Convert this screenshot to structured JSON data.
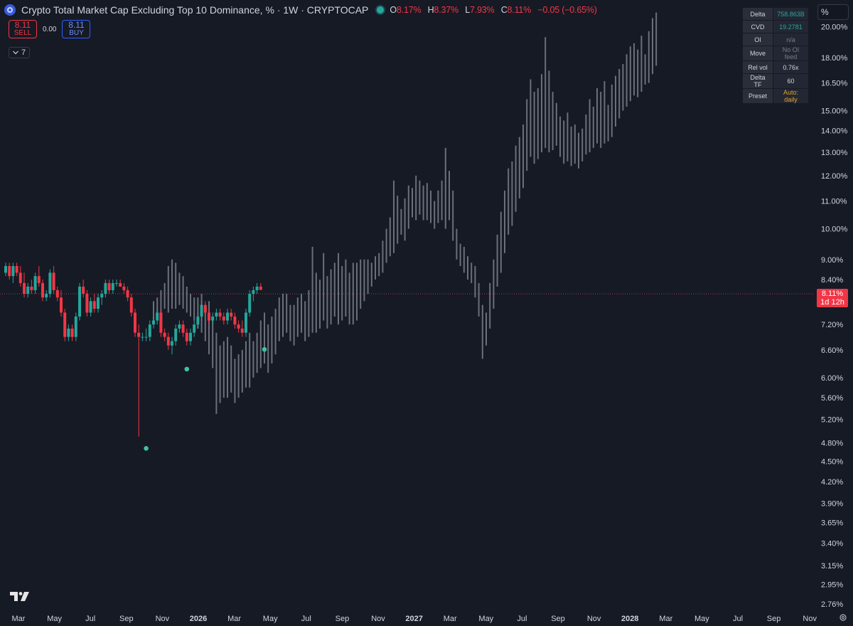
{
  "header": {
    "title": "Crypto Total Market Cap Excluding Top 10 Dominance, % · 1W · CRYPTOCAP",
    "ohlc": {
      "o_key": "O",
      "o_val": "8.17%",
      "h_key": "H",
      "h_val": "8.37%",
      "l_key": "L",
      "l_val": "7.93%",
      "c_key": "C",
      "c_val": "8.11%",
      "change": "−0.05 (−0.65%)"
    }
  },
  "trade": {
    "sell_price": "8.11",
    "sell_label": "SELL",
    "spread": "0.00",
    "buy_price": "8.11",
    "buy_label": "BUY"
  },
  "indicators_toggle": {
    "count": "7"
  },
  "axis_button": {
    "label": "%"
  },
  "data_table": [
    {
      "label": "Delta",
      "value": "758.863B",
      "color": "#26a69a"
    },
    {
      "label": "CVD",
      "value": "19.2781",
      "color": "#26a69a"
    },
    {
      "label": "OI",
      "value": "n/a",
      "color": "#787b86"
    },
    {
      "label": "Move",
      "value": "No OI feed",
      "color": "#787b86"
    },
    {
      "label": "Rel vol",
      "value": "0.76x",
      "color": "#d1d4dc"
    },
    {
      "label": "Delta TF",
      "value": "60",
      "color": "#d1d4dc"
    },
    {
      "label": "Preset",
      "value": "Auto: daily",
      "color": "#e0a32e"
    }
  ],
  "price_tag": {
    "value": "8.11%",
    "countdown": "1d 12h"
  },
  "chart_data": {
    "type": "candlestick",
    "title": "Crypto Total Market Cap Excluding Top 10 Dominance, %",
    "y_scale": "log",
    "ylim": [
      2.7,
      21.5
    ],
    "y_ticks": [
      "20.00%",
      "18.00%",
      "16.50%",
      "15.00%",
      "14.00%",
      "13.00%",
      "12.00%",
      "11.00%",
      "10.00%",
      "9.00%",
      "8.40%",
      "7.20%",
      "6.60%",
      "6.00%",
      "5.60%",
      "5.20%",
      "4.80%",
      "4.50%",
      "4.20%",
      "3.90%",
      "3.65%",
      "3.40%",
      "3.15%",
      "2.95%",
      "2.76%"
    ],
    "x_ticks": [
      "Mar",
      "May",
      "Jul",
      "Sep",
      "Nov",
      "2026",
      "Mar",
      "May",
      "Jul",
      "Sep",
      "Nov",
      "2027",
      "Mar",
      "May",
      "Jul",
      "Sep",
      "Nov",
      "2028",
      "Mar",
      "May",
      "Jul",
      "Sep",
      "Nov"
    ],
    "bold_x_ticks": [
      "2026",
      "2027",
      "2028"
    ],
    "current_value": 8.11,
    "colors": {
      "up": "#26a69a",
      "down": "#f23645",
      "projection": "#6b6f7a",
      "background": "#161a25"
    },
    "candles": [
      [
        8.6,
        8.9,
        8.5,
        8.8
      ],
      [
        8.8,
        8.9,
        8.4,
        8.5
      ],
      [
        8.5,
        8.9,
        8.3,
        8.8
      ],
      [
        8.8,
        8.9,
        8.5,
        8.6
      ],
      [
        8.6,
        8.8,
        8.2,
        8.3
      ],
      [
        8.3,
        8.6,
        7.9,
        8.0
      ],
      [
        8.0,
        8.3,
        7.9,
        8.2
      ],
      [
        8.2,
        8.4,
        8.0,
        8.1
      ],
      [
        8.1,
        8.6,
        8.0,
        8.5
      ],
      [
        8.5,
        8.8,
        8.2,
        8.3
      ],
      [
        8.3,
        8.4,
        7.8,
        7.9
      ],
      [
        7.9,
        8.1,
        7.8,
        8.0
      ],
      [
        8.0,
        8.7,
        7.9,
        8.6
      ],
      [
        8.6,
        8.8,
        8.0,
        8.1
      ],
      [
        8.1,
        8.2,
        7.8,
        7.9
      ],
      [
        7.9,
        8.1,
        7.4,
        7.5
      ],
      [
        7.5,
        7.6,
        6.8,
        6.9
      ],
      [
        6.9,
        7.2,
        6.8,
        7.1
      ],
      [
        7.1,
        7.2,
        6.8,
        6.9
      ],
      [
        6.9,
        7.5,
        6.8,
        7.4
      ],
      [
        7.4,
        8.3,
        7.3,
        8.2
      ],
      [
        8.2,
        8.4,
        7.9,
        8.0
      ],
      [
        8.0,
        8.1,
        7.4,
        7.5
      ],
      [
        7.5,
        7.9,
        7.4,
        7.8
      ],
      [
        7.8,
        8.0,
        7.5,
        7.6
      ],
      [
        7.6,
        8.0,
        7.5,
        7.9
      ],
      [
        7.9,
        8.1,
        7.7,
        8.0
      ],
      [
        8.0,
        8.4,
        7.9,
        8.3
      ],
      [
        8.3,
        8.4,
        8.0,
        8.1
      ],
      [
        8.1,
        8.4,
        8.0,
        8.3
      ],
      [
        8.3,
        8.4,
        8.2,
        8.3
      ],
      [
        8.3,
        8.4,
        8.2,
        8.2
      ],
      [
        8.2,
        8.3,
        8.0,
        8.1
      ],
      [
        8.1,
        8.2,
        7.8,
        7.9
      ],
      [
        7.9,
        8.0,
        7.4,
        7.5
      ],
      [
        7.5,
        7.6,
        6.9,
        7.0
      ],
      [
        7.0,
        7.2,
        4.9,
        6.9
      ],
      [
        6.9,
        7.0,
        6.8,
        6.9
      ],
      [
        6.9,
        7.1,
        6.8,
        6.9
      ],
      [
        6.9,
        7.3,
        6.8,
        7.2
      ],
      [
        7.2,
        7.4,
        7.1,
        7.3
      ],
      [
        7.3,
        7.6,
        7.2,
        7.5
      ],
      [
        7.5,
        7.6,
        6.9,
        7.0
      ],
      [
        7.0,
        7.1,
        6.8,
        6.9
      ],
      [
        6.9,
        7.0,
        6.6,
        6.7
      ],
      [
        6.7,
        6.9,
        6.5,
        6.8
      ],
      [
        6.8,
        7.2,
        6.7,
        7.1
      ],
      [
        7.1,
        7.3,
        7.0,
        7.2
      ],
      [
        7.2,
        7.3,
        6.9,
        7.0
      ],
      [
        7.0,
        7.1,
        6.7,
        6.8
      ],
      [
        6.8,
        7.1,
        6.7,
        7.0
      ],
      [
        7.0,
        7.3,
        6.9,
        7.2
      ],
      [
        7.2,
        7.5,
        7.1,
        7.4
      ],
      [
        7.4,
        7.8,
        7.3,
        7.7
      ],
      [
        7.7,
        7.8,
        7.4,
        7.5
      ],
      [
        7.5,
        7.6,
        7.2,
        7.3
      ],
      [
        7.3,
        7.5,
        7.2,
        7.4
      ],
      [
        7.4,
        7.6,
        7.3,
        7.5
      ],
      [
        7.5,
        7.6,
        7.3,
        7.4
      ],
      [
        7.4,
        7.5,
        7.2,
        7.3
      ],
      [
        7.3,
        7.6,
        7.2,
        7.5
      ],
      [
        7.5,
        7.6,
        7.3,
        7.4
      ],
      [
        7.4,
        7.5,
        7.1,
        7.2
      ],
      [
        7.2,
        7.3,
        7.0,
        7.1
      ],
      [
        7.1,
        7.3,
        6.9,
        7.0
      ],
      [
        7.0,
        7.6,
        6.9,
        7.5
      ],
      [
        7.5,
        8.1,
        7.4,
        8.0
      ],
      [
        8.0,
        8.2,
        7.8,
        8.1
      ],
      [
        8.1,
        8.3,
        8.0,
        8.2
      ],
      [
        8.2,
        8.3,
        8.1,
        8.11
      ]
    ],
    "projection": [
      [
        7.3,
        7.8
      ],
      [
        7.4,
        7.9
      ],
      [
        7.5,
        8.1
      ],
      [
        7.6,
        8.3
      ],
      [
        7.5,
        8.8
      ],
      [
        7.6,
        9.0
      ],
      [
        7.6,
        8.9
      ],
      [
        7.7,
        8.6
      ],
      [
        7.6,
        8.5
      ],
      [
        7.5,
        8.2
      ],
      [
        7.4,
        8.0
      ],
      [
        7.3,
        7.9
      ],
      [
        7.1,
        7.9
      ],
      [
        7.0,
        8.0
      ],
      [
        6.8,
        7.7
      ],
      [
        6.5,
        7.8
      ],
      [
        6.2,
        7.4
      ],
      [
        5.3,
        7.0
      ],
      [
        5.5,
        6.7
      ],
      [
        5.6,
        6.8
      ],
      [
        5.6,
        6.9
      ],
      [
        5.7,
        6.7
      ],
      [
        5.5,
        6.4
      ],
      [
        5.6,
        6.5
      ],
      [
        5.7,
        6.6
      ],
      [
        5.8,
        6.8
      ],
      [
        5.8,
        7.0
      ],
      [
        6.0,
        6.8
      ],
      [
        6.1,
        7.0
      ],
      [
        6.2,
        7.3
      ],
      [
        6.3,
        7.5
      ],
      [
        6.1,
        7.2
      ],
      [
        6.3,
        7.4
      ],
      [
        6.5,
        7.6
      ],
      [
        6.8,
        7.9
      ],
      [
        6.9,
        8.0
      ],
      [
        7.0,
        8.0
      ],
      [
        6.8,
        7.7
      ],
      [
        6.7,
        7.7
      ],
      [
        6.9,
        7.9
      ],
      [
        7.0,
        8.0
      ],
      [
        6.8,
        7.8
      ],
      [
        6.9,
        8.1
      ],
      [
        7.0,
        9.4
      ],
      [
        7.0,
        8.6
      ],
      [
        7.1,
        8.4
      ],
      [
        7.3,
        9.2
      ],
      [
        7.1,
        8.5
      ],
      [
        7.2,
        8.7
      ],
      [
        7.4,
        8.9
      ],
      [
        7.2,
        9.2
      ],
      [
        7.3,
        8.8
      ],
      [
        7.4,
        9.0
      ],
      [
        7.2,
        8.6
      ],
      [
        7.2,
        8.9
      ],
      [
        7.3,
        8.9
      ],
      [
        7.6,
        9.0
      ],
      [
        7.8,
        9.0
      ],
      [
        8.0,
        9.0
      ],
      [
        8.2,
        8.9
      ],
      [
        8.4,
        9.1
      ],
      [
        8.5,
        9.2
      ],
      [
        8.6,
        9.6
      ],
      [
        8.9,
        10.0
      ],
      [
        9.1,
        10.4
      ],
      [
        9.2,
        11.8
      ],
      [
        9.5,
        11.2
      ],
      [
        9.8,
        10.7
      ],
      [
        9.6,
        11.1
      ],
      [
        10.0,
        11.6
      ],
      [
        10.4,
        11.5
      ],
      [
        10.3,
        12.0
      ],
      [
        10.5,
        11.8
      ],
      [
        10.3,
        11.6
      ],
      [
        10.3,
        11.7
      ],
      [
        10.2,
        11.4
      ],
      [
        10.0,
        11.0
      ],
      [
        10.2,
        11.4
      ],
      [
        10.3,
        11.8
      ],
      [
        10.0,
        13.2
      ],
      [
        10.3,
        12.2
      ],
      [
        9.6,
        11.4
      ],
      [
        9.0,
        10.0
      ],
      [
        8.8,
        9.5
      ],
      [
        8.6,
        9.4
      ],
      [
        8.4,
        9.1
      ],
      [
        8.3,
        8.9
      ],
      [
        7.9,
        8.8
      ],
      [
        7.4,
        8.3
      ],
      [
        6.4,
        7.7
      ],
      [
        6.7,
        7.5
      ],
      [
        7.1,
        8.3
      ],
      [
        7.6,
        9.0
      ],
      [
        8.2,
        9.8
      ],
      [
        8.6,
        10.6
      ],
      [
        9.2,
        11.4
      ],
      [
        9.8,
        12.3
      ],
      [
        10.1,
        12.6
      ],
      [
        10.6,
        13.3
      ],
      [
        11.1,
        13.7
      ],
      [
        11.5,
        14.3
      ],
      [
        12.2,
        15.6
      ],
      [
        12.8,
        16.7
      ],
      [
        12.5,
        16.0
      ],
      [
        12.7,
        16.2
      ],
      [
        13.0,
        17.0
      ],
      [
        13.2,
        19.3
      ],
      [
        13.0,
        17.2
      ],
      [
        13.1,
        16.0
      ],
      [
        13.3,
        15.4
      ],
      [
        12.8,
        14.7
      ],
      [
        12.5,
        14.5
      ],
      [
        12.6,
        14.9
      ],
      [
        12.4,
        14.2
      ],
      [
        12.5,
        14.3
      ],
      [
        12.3,
        13.9
      ],
      [
        12.6,
        14.1
      ],
      [
        12.9,
        14.8
      ],
      [
        13.0,
        15.6
      ],
      [
        13.2,
        15.2
      ],
      [
        13.4,
        16.2
      ],
      [
        13.2,
        16.0
      ],
      [
        13.4,
        16.6
      ],
      [
        13.5,
        15.3
      ],
      [
        13.7,
        16.4
      ],
      [
        14.2,
        16.9
      ],
      [
        14.6,
        17.3
      ],
      [
        15.0,
        17.6
      ],
      [
        15.2,
        18.2
      ],
      [
        15.5,
        18.7
      ],
      [
        15.8,
        18.9
      ],
      [
        15.7,
        18.5
      ],
      [
        16.0,
        19.4
      ],
      [
        16.4,
        18.2
      ],
      [
        16.5,
        19.7
      ],
      [
        17.0,
        20.6
      ],
      [
        17.5,
        21.0
      ]
    ]
  }
}
